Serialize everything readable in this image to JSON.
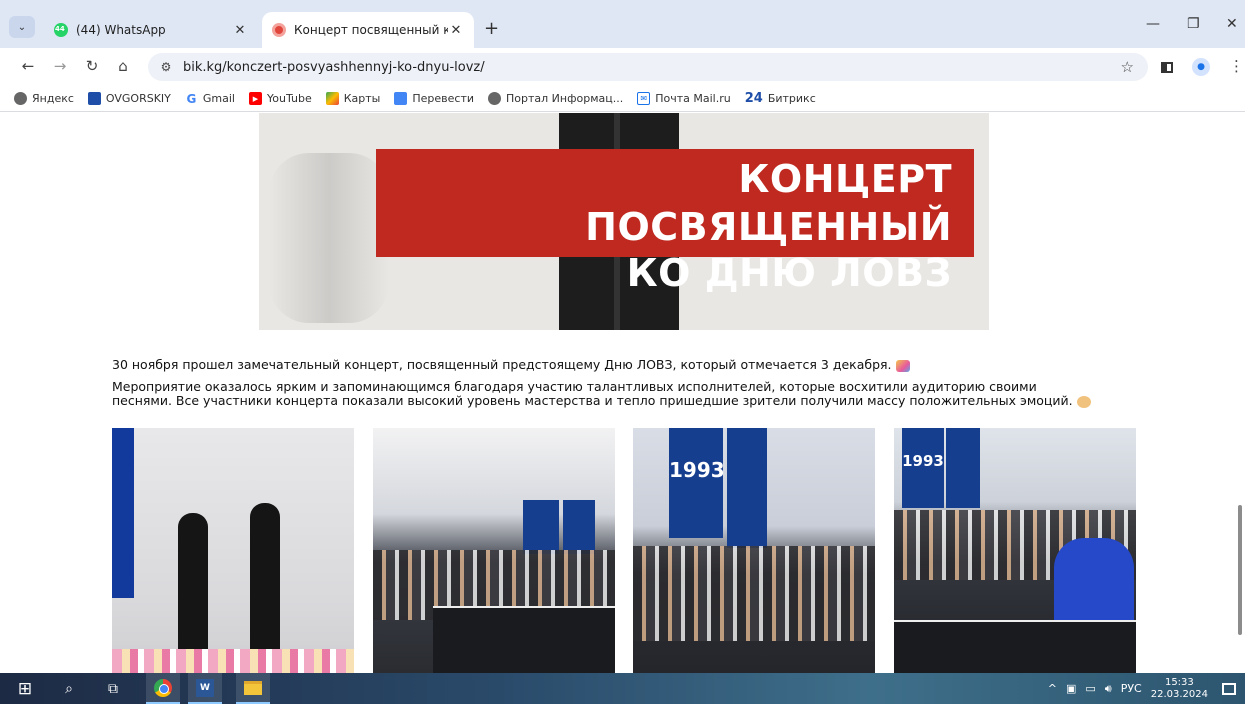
{
  "browser": {
    "tabs": [
      {
        "title": "(44) WhatsApp",
        "favicon": "whatsapp-icon",
        "active": false
      },
      {
        "title": "Концерт посвященный ко дню",
        "favicon": "bik-favicon",
        "active": true
      }
    ],
    "new_tab": "+",
    "address": "bik.kg/konczert-posvyashhennyj-ko-dnyu-lovz/",
    "bookmarks": [
      {
        "label": "Яндекс",
        "icon": "globe-icon"
      },
      {
        "label": "OVGORSKIY",
        "icon": "ovgorskiy-icon"
      },
      {
        "label": "Gmail",
        "icon": "google-icon"
      },
      {
        "label": "YouTube",
        "icon": "youtube-icon"
      },
      {
        "label": "Карты",
        "icon": "maps-icon"
      },
      {
        "label": "Перевести",
        "icon": "translate-icon"
      },
      {
        "label": "Портал Информац...",
        "icon": "globe-icon"
      },
      {
        "label": "Почта Mail.ru",
        "icon": "mail-icon"
      },
      {
        "label": "Битрикс",
        "icon": "bitrix24-icon",
        "prefix": "24"
      }
    ]
  },
  "article": {
    "hero_line1": "КОНЦЕРТ ПОСВЯЩЕННЫЙ",
    "hero_line2": "КО ДНЮ ЛОВЗ",
    "paragraph1": "30 ноября прошел замечательный концерт, посвященный предстоящему Дню ЛОВЗ, который отмечается 3 декабря.",
    "paragraph2": "Мероприятие оказалось ярким и запоминающимся благодаря участию талантливых исполнителей, которые восхитили аудиторию своими песнями. Все участники концерта показали высокий уровень мастерства и тепло пришедшие зрители получили массу положительных эмоций.",
    "photo_banner_year": "1993"
  },
  "taskbar": {
    "language": "РУС",
    "time": "15:33",
    "date": "22.03.2024"
  },
  "colors": {
    "hero_red": "#c0291f",
    "tabstrip": "#dfe7f5",
    "banner_blue": "#163e8f"
  }
}
